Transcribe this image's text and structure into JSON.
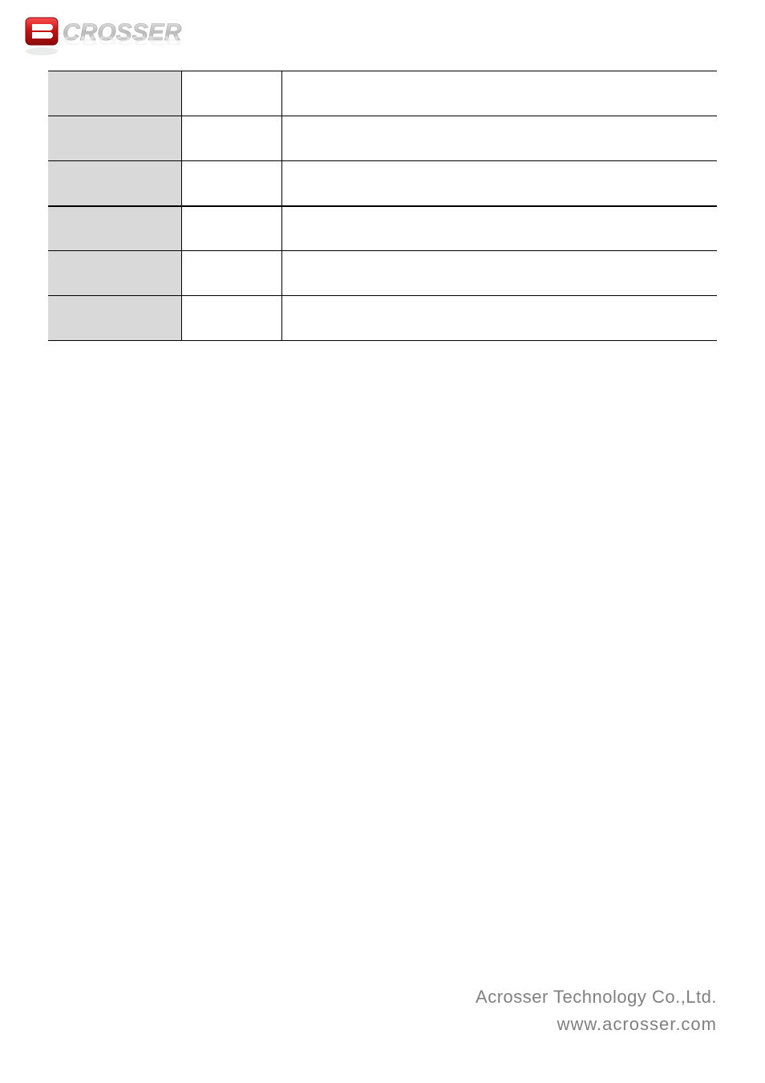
{
  "logo": {
    "alt": "ACROSSER"
  },
  "table": {
    "rows": [
      {
        "label": "",
        "sub": "",
        "value": ""
      },
      {
        "label": "",
        "sub": "",
        "value": ""
      },
      {
        "label": "",
        "sub": "",
        "value": ""
      },
      {
        "label": "",
        "sub": "",
        "value": ""
      },
      {
        "label": "",
        "sub": "",
        "value": ""
      },
      {
        "label": "",
        "sub": "",
        "value": ""
      }
    ]
  },
  "footer": {
    "company": "Acrosser Technology Co.,Ltd.",
    "url": "www.acrosser.com"
  }
}
